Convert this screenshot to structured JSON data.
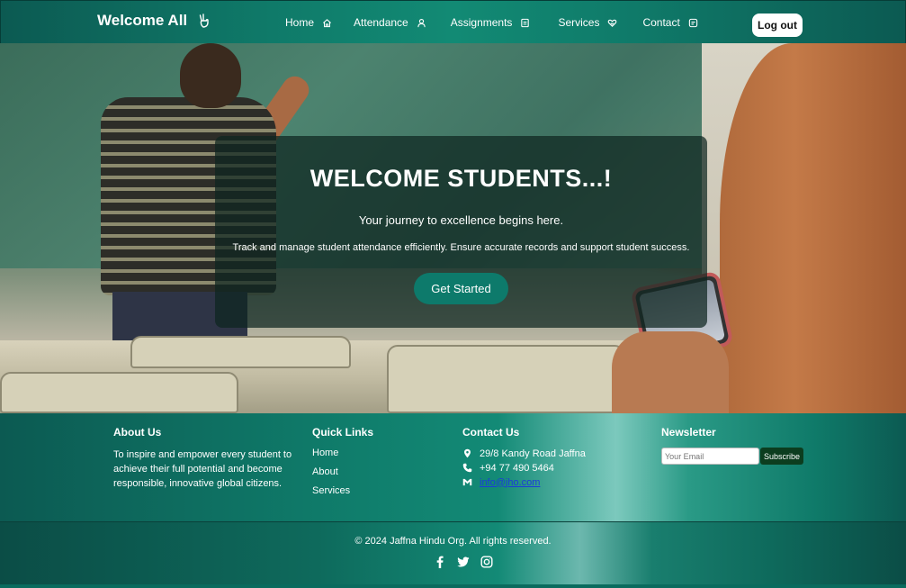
{
  "nav": {
    "brand": "Welcome All",
    "items": [
      {
        "label": "Home",
        "icon": "home-icon"
      },
      {
        "label": "Attendance",
        "icon": "user-icon"
      },
      {
        "label": "Assignments",
        "icon": "document-icon"
      },
      {
        "label": "Services",
        "icon": "heart-hand-icon"
      },
      {
        "label": "Contact",
        "icon": "message-icon"
      }
    ],
    "logout_label": "Log out"
  },
  "hero": {
    "title": "WELCOME STUDENTS...!",
    "subtitle": "Your journey to excellence begins here.",
    "description": "Track and manage student attendance efficiently. Ensure accurate records and support student success.",
    "cta_label": "Get Started"
  },
  "footer": {
    "about": {
      "heading": "About Us",
      "text": "To inspire and empower every student to achieve their full potential and become responsible, innovative global citizens."
    },
    "quick_links": {
      "heading": "Quick Links",
      "links": [
        "Home",
        "About",
        "Services"
      ]
    },
    "contact": {
      "heading": "Contact Us",
      "address": "29/8 Kandy Road Jaffna",
      "phone": "+94 77 490 5464",
      "email": "info@jho.com"
    },
    "newsletter": {
      "heading": "Newsletter",
      "placeholder": "Your Email",
      "button_label": "Subscribe"
    },
    "copyright": "© 2024 Jaffna Hindu Org. All rights reserved.",
    "socials": [
      "facebook-icon",
      "twitter-icon",
      "instagram-icon"
    ]
  },
  "colors": {
    "primary": "#0f7a69",
    "cta": "#0d7a6b",
    "subscribe": "#0c3d1f"
  }
}
